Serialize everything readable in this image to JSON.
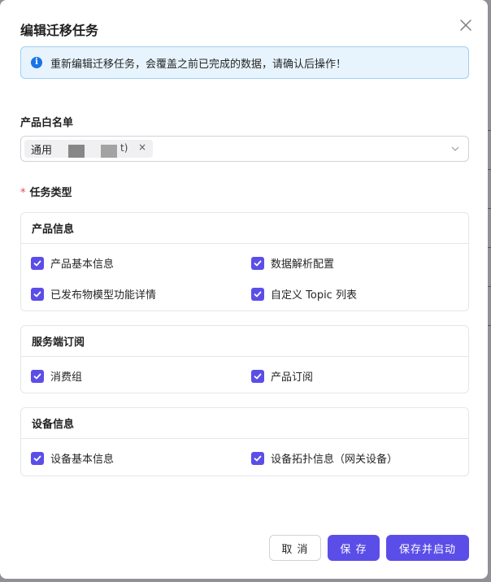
{
  "dialog": {
    "title": "编辑迁移任务",
    "alert_text": "重新编辑迁移任务，会覆盖之前已完成的数据，请确认后操作！"
  },
  "whitelist": {
    "label": "产品白名单",
    "tag_label": "通用",
    "tag_tail": "t)",
    "tag_close": "×"
  },
  "task_type": {
    "required_mark": "*",
    "label": "任务类型"
  },
  "groups": [
    {
      "title": "产品信息",
      "items": [
        {
          "label": "产品基本信息",
          "checked": true
        },
        {
          "label": "数据解析配置",
          "checked": true
        },
        {
          "label": "已发布物模型功能详情",
          "checked": true
        },
        {
          "label": "自定义 Topic 列表",
          "checked": true
        }
      ]
    },
    {
      "title": "服务端订阅",
      "items": [
        {
          "label": "消费组",
          "checked": true
        },
        {
          "label": "产品订阅",
          "checked": true
        }
      ]
    },
    {
      "title": "设备信息",
      "items": [
        {
          "label": "设备基本信息",
          "checked": true
        },
        {
          "label": "设备拓扑信息（网关设备）",
          "checked": true
        }
      ]
    }
  ],
  "footer": {
    "cancel_label": "取 消",
    "save_label": "保 存",
    "save_start_label": "保存并启动"
  },
  "colors": {
    "primary": "#5b4ee8",
    "info": "#1a74e8",
    "alert_bg": "#e7f4fd",
    "required": "#e5484d"
  },
  "icons": {
    "close": "close-icon",
    "info": "info-icon",
    "dropdown": "chevron-down-icon",
    "checkbox": "checkmark-icon"
  }
}
